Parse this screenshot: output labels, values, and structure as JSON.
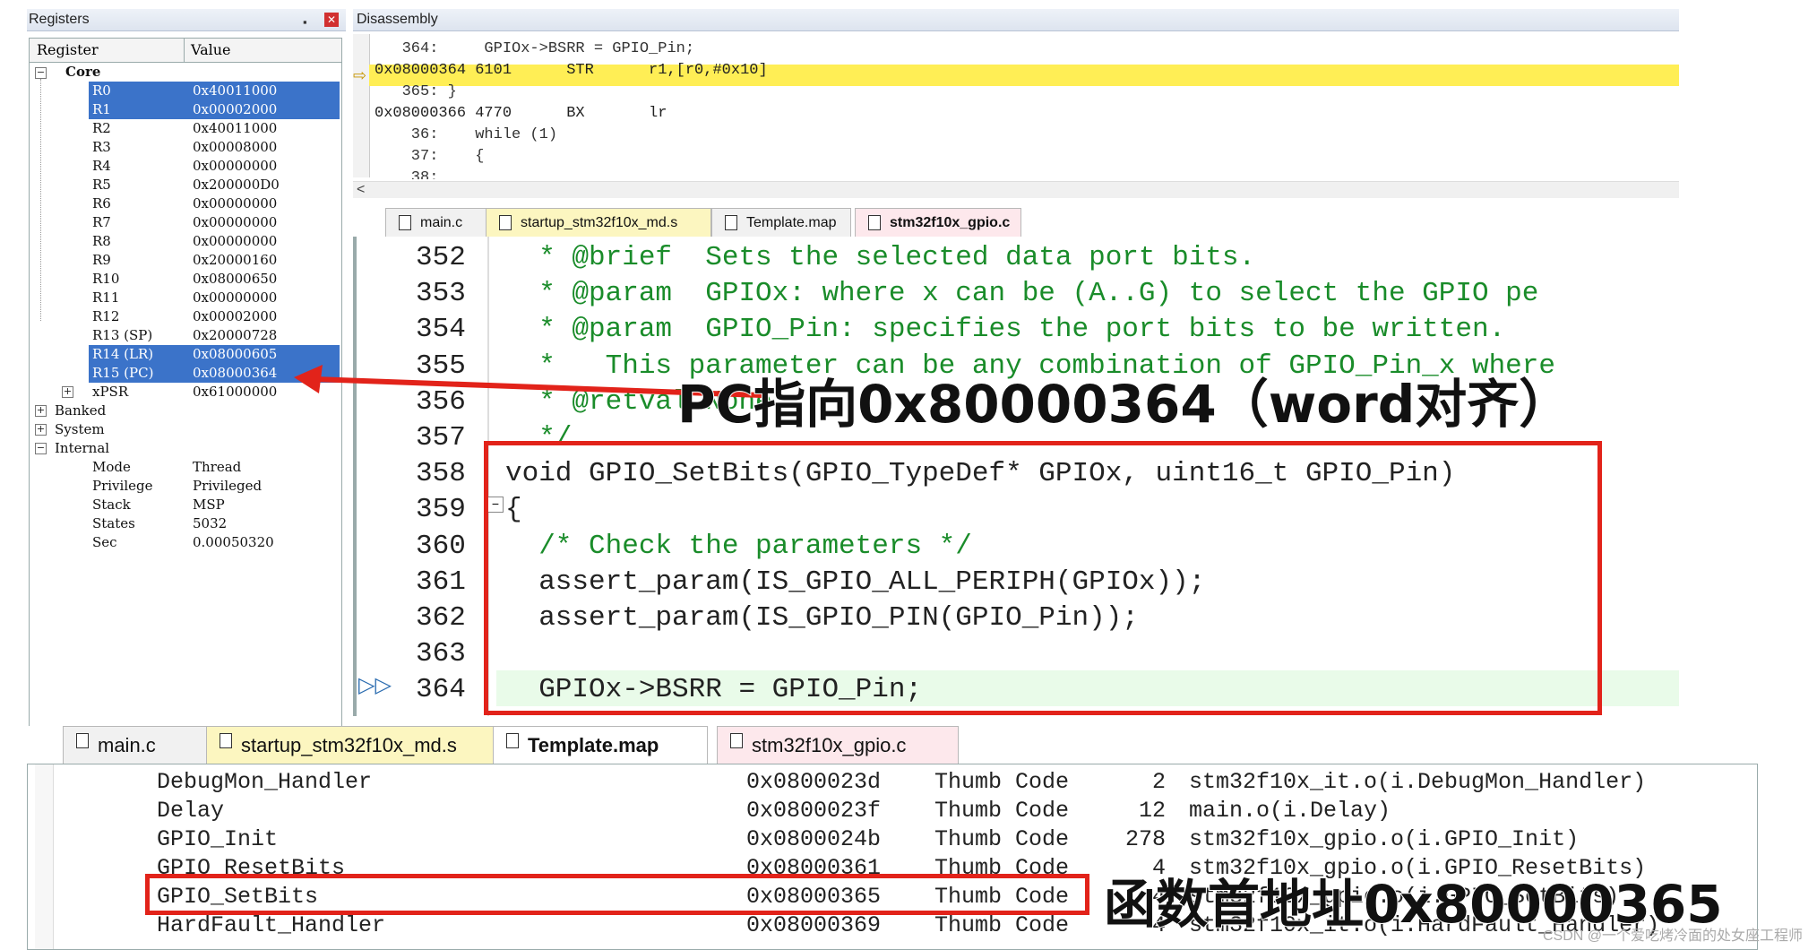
{
  "registers_panel": {
    "title": "Registers",
    "pin_icon": "▪",
    "col_register": "Register",
    "col_value": "Value",
    "core_label": "Core",
    "rows": [
      {
        "name": "R0",
        "value": "0x40011000",
        "selected": true
      },
      {
        "name": "R1",
        "value": "0x00002000",
        "selected": true
      },
      {
        "name": "R2",
        "value": "0x40011000",
        "selected": false
      },
      {
        "name": "R3",
        "value": "0x00008000",
        "selected": false
      },
      {
        "name": "R4",
        "value": "0x00000000",
        "selected": false
      },
      {
        "name": "R5",
        "value": "0x200000D0",
        "selected": false
      },
      {
        "name": "R6",
        "value": "0x00000000",
        "selected": false
      },
      {
        "name": "R7",
        "value": "0x00000000",
        "selected": false
      },
      {
        "name": "R8",
        "value": "0x00000000",
        "selected": false
      },
      {
        "name": "R9",
        "value": "0x20000160",
        "selected": false
      },
      {
        "name": "R10",
        "value": "0x08000650",
        "selected": false
      },
      {
        "name": "R11",
        "value": "0x00000000",
        "selected": false
      },
      {
        "name": "R12",
        "value": "0x00002000",
        "selected": false
      },
      {
        "name": "R13 (SP)",
        "value": "0x20000728",
        "selected": false
      },
      {
        "name": "R14 (LR)",
        "value": "0x08000605",
        "selected": true
      },
      {
        "name": "R15 (PC)",
        "value": "0x08000364",
        "selected": true
      },
      {
        "name": "xPSR",
        "value": "0x61000000",
        "selected": false
      }
    ],
    "groups": [
      "Banked",
      "System",
      "Internal"
    ],
    "internal_rows": [
      {
        "name": "Mode",
        "value": "Thread"
      },
      {
        "name": "Privilege",
        "value": "Privileged"
      },
      {
        "name": "Stack",
        "value": "MSP"
      },
      {
        "name": "States",
        "value": "5032"
      },
      {
        "name": "Sec",
        "value": "0.00050320"
      }
    ]
  },
  "disassembly": {
    "title": "Disassembly",
    "lines": [
      "   364:     GPIOx->BSRR = GPIO_Pin;",
      "0x08000364 6101      STR      r1,[r0,#0x10]",
      "   365: }",
      "0x08000366 4770      BX       lr",
      "    36:    while (1)",
      "    37:    {",
      "    38:"
    ],
    "scroll_left": "<"
  },
  "editor_tabs": [
    {
      "label": "main.c"
    },
    {
      "label": "startup_stm32f10x_md.s"
    },
    {
      "label": "Template.map"
    },
    {
      "label": "stm32f10x_gpio.c"
    }
  ],
  "code": {
    "line_numbers": [
      "352",
      "353",
      "354",
      "355",
      "356",
      "357",
      "358",
      "359",
      "360",
      "361",
      "362",
      "363",
      "364"
    ],
    "lines": [
      "  * @brief  Sets the selected data port bits.",
      "  * @param  GPIOx: where x can be (A..G) to select the GPIO pe",
      "  * @param  GPIO_Pin: specifies the port bits to be written.",
      "  *   This parameter can be any combination of GPIO_Pin_x where",
      "  * @retval None",
      "  */",
      "void GPIO_SetBits(GPIO_TypeDef* GPIOx, uint16_t GPIO_Pin)",
      "{",
      "  /* Check the parameters */",
      "  assert_param(IS_GPIO_ALL_PERIPH(GPIOx));",
      "  assert_param(IS_GPIO_PIN(GPIO_Pin));",
      "",
      "  GPIOx->BSRR = GPIO_Pin;"
    ]
  },
  "bottom_tabs": [
    {
      "label": "main.c"
    },
    {
      "label": "startup_stm32f10x_md.s"
    },
    {
      "label": "Template.map"
    },
    {
      "label": "stm32f10x_gpio.c"
    }
  ],
  "map_rows": [
    {
      "symbol": "DebugMon_Handler",
      "addr": "0x0800023d",
      "type": "Thumb Code",
      "size": "2",
      "obj": "stm32f10x_it.o(i.DebugMon_Handler)"
    },
    {
      "symbol": "Delay",
      "addr": "0x0800023f",
      "type": "Thumb Code",
      "size": "12",
      "obj": "main.o(i.Delay)"
    },
    {
      "symbol": "GPIO_Init",
      "addr": "0x0800024b",
      "type": "Thumb Code",
      "size": "278",
      "obj": "stm32f10x_gpio.o(i.GPIO_Init)"
    },
    {
      "symbol": "GPIO_ResetBits",
      "addr": "0x08000361",
      "type": "Thumb Code",
      "size": "4",
      "obj": "stm32f10x_gpio.o(i.GPIO_ResetBits)"
    },
    {
      "symbol": "GPIO_SetBits",
      "addr": "0x08000365",
      "type": "Thumb Code",
      "size": "4",
      "obj": "stm32f10x_gpio.o(i.GPIO_SetBits)"
    },
    {
      "symbol": "HardFault_Handler",
      "addr": "0x08000369",
      "type": "Thumb Code",
      "size": "4",
      "obj": "stm32f10x_it.o(i.HardFault_Handler)"
    }
  ],
  "annotations": {
    "pc_note": "PC指向0x80000364（word对齐）",
    "func_note": "函数首地址0x80000365"
  },
  "watermark": "CSDN @一个爱吃烤冷面的处女座工程师",
  "colors": {
    "accent_red": "#e2231a",
    "highlight_yellow": "#ffee55",
    "selection_blue": "#3b73c9"
  }
}
